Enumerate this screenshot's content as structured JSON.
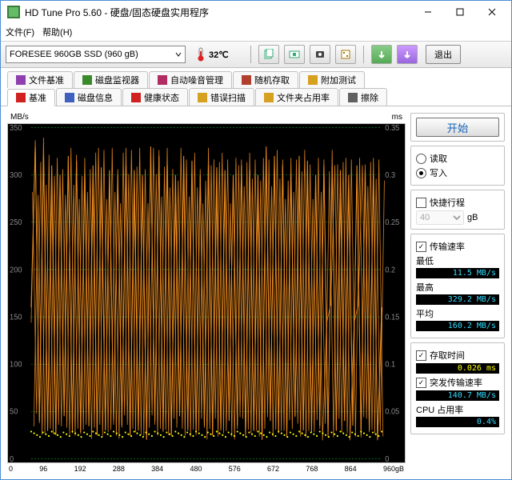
{
  "window": {
    "title": "HD Tune Pro 5.60 - 硬盘/固态硬盘实用程序"
  },
  "menu": {
    "file": "文件(F)",
    "help": "帮助(H)"
  },
  "toolbar": {
    "drive": "FORESEE 960GB SSD (960 gB)",
    "temperature": "32℃",
    "exit": "退出"
  },
  "tabs_row1": [
    {
      "label": "文件基准",
      "icon": "#8e3fb0"
    },
    {
      "label": "磁盘监视器",
      "icon": "#3a8a2c"
    },
    {
      "label": "自动噪音管理",
      "icon": "#b02c63"
    },
    {
      "label": "随机存取",
      "icon": "#b0402c"
    },
    {
      "label": "附加测试",
      "icon": "#d6a020"
    }
  ],
  "tabs_row2": [
    {
      "label": "基准",
      "icon": "#d02020",
      "active": true
    },
    {
      "label": "磁盘信息",
      "icon": "#4060c0"
    },
    {
      "label": "健康状态",
      "icon": "#d02020"
    },
    {
      "label": "错误扫描",
      "icon": "#d6a020"
    },
    {
      "label": "文件夹占用率",
      "icon": "#d6a020"
    },
    {
      "label": "擦除",
      "icon": "#606060"
    }
  ],
  "chart_hdr": {
    "left_unit": "MB/s",
    "right_unit": "ms"
  },
  "side": {
    "start": "开始",
    "read": "读取",
    "write": "写入",
    "shortstroke": "快捷行程",
    "blocksize": "40",
    "blocksize_unit": "gB",
    "rate_title": "传输速率",
    "min_lbl": "最低",
    "min_val": "11.5 MB/s",
    "max_lbl": "最高",
    "max_val": "329.2 MB/s",
    "avg_lbl": "平均",
    "avg_val": "160.2 MB/s",
    "access_title": "存取时间",
    "access_val": "0.026 ms",
    "burst_title": "突发传输速率",
    "burst_val": "140.7 MB/s",
    "cpu_title": "CPU 占用率",
    "cpu_val": "0.4%"
  },
  "chart_data": {
    "type": "line",
    "title": "",
    "xlabel": "gB",
    "ylabel": "MB/s",
    "y2label": "ms",
    "xlim": [
      0,
      960
    ],
    "ylim": [
      0,
      350
    ],
    "y2lim": [
      0,
      0.35
    ],
    "x_ticks": [
      0,
      96,
      192,
      288,
      384,
      480,
      576,
      672,
      768,
      864,
      "960gB"
    ],
    "y_ticks": [
      0,
      50,
      100,
      150,
      200,
      250,
      300,
      350
    ],
    "y2_ticks": [
      0,
      0.05,
      0.1,
      0.15,
      0.2,
      0.25,
      0.3,
      0.35
    ],
    "series": [
      {
        "name": "transfer_rate_MBps",
        "color": "#e88a20",
        "values": [
          160,
          330,
          40,
          320,
          30,
          310,
          25,
          300,
          45,
          320,
          30,
          315,
          28,
          300,
          35,
          310,
          25,
          308,
          30,
          305,
          40,
          300,
          35,
          310,
          25,
          305,
          30,
          300,
          20,
          330,
          40,
          320,
          30,
          310,
          25,
          300,
          45,
          320,
          30,
          315,
          28,
          300,
          35,
          310,
          25,
          308,
          30,
          305,
          40,
          300,
          35,
          310,
          25,
          305,
          30,
          300,
          20,
          330,
          40,
          320,
          30,
          310,
          25,
          300,
          45,
          320,
          30,
          315,
          28,
          300,
          35,
          310,
          25,
          308,
          30,
          305,
          40,
          300,
          35,
          310,
          25,
          305,
          30,
          300,
          20,
          160
        ]
      },
      {
        "name": "access_time_ms",
        "color": "#ffff00",
        "values_approx_constant": 0.026
      }
    ]
  }
}
